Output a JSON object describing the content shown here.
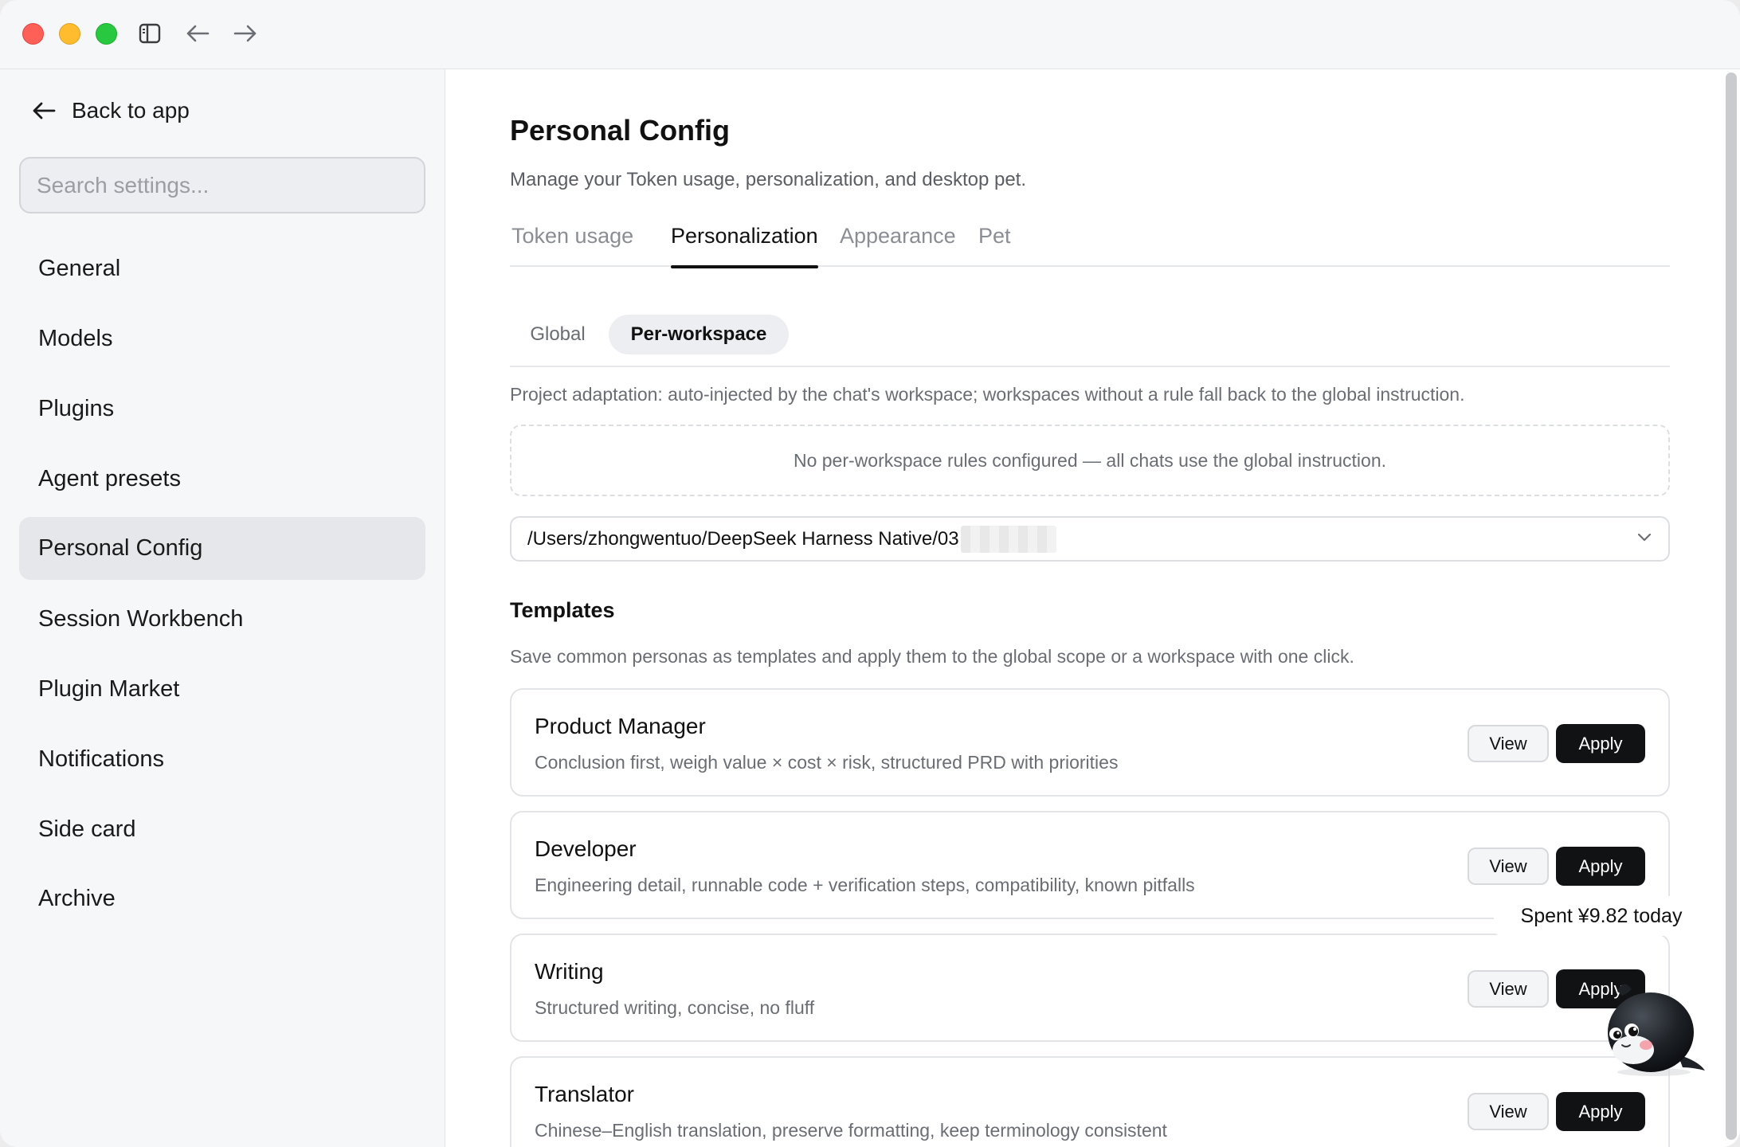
{
  "titlebar": {
    "sidebar_toggle_icon": "sidebar-toggle-icon",
    "back_icon": "arrow-left-icon",
    "forward_icon": "arrow-right-icon"
  },
  "sidebar": {
    "back_label": "Back to app",
    "search_placeholder": "Search settings...",
    "items": [
      {
        "label": "General",
        "active": false
      },
      {
        "label": "Models",
        "active": false
      },
      {
        "label": "Plugins",
        "active": false
      },
      {
        "label": "Agent presets",
        "active": false
      },
      {
        "label": "Personal Config",
        "active": true
      },
      {
        "label": "Session Workbench",
        "active": false
      },
      {
        "label": "Plugin Market",
        "active": false
      },
      {
        "label": "Notifications",
        "active": false
      },
      {
        "label": "Side card",
        "active": false
      },
      {
        "label": "Archive",
        "active": false
      }
    ]
  },
  "main": {
    "title": "Personal Config",
    "subtitle": "Manage your Token usage, personalization, and desktop pet.",
    "tabs": [
      {
        "label": "Token usage",
        "active": false
      },
      {
        "label": "Personalization",
        "active": true
      },
      {
        "label": "Appearance",
        "active": false
      },
      {
        "label": "Pet",
        "active": false
      }
    ],
    "subtabs": [
      {
        "label": "Global",
        "active": false
      },
      {
        "label": "Per-workspace",
        "active": true
      }
    ],
    "hint": "Project adaptation: auto-injected by the chat's workspace; workspaces without a rule fall back to the global instruction.",
    "empty_message": "No per-workspace rules configured — all chats use the global instruction.",
    "workspace_select_value": "/Users/zhongwentuo/DeepSeek Harness Native/03",
    "templates": {
      "title": "Templates",
      "description": "Save common personas as templates and apply them to the global scope or a workspace with one click.",
      "view_label": "View",
      "apply_label": "Apply",
      "items": [
        {
          "name": "Product Manager",
          "desc": "Conclusion first, weigh value × cost × risk, structured PRD with priorities"
        },
        {
          "name": "Developer",
          "desc": "Engineering detail, runnable code + verification steps, compatibility, known pitfalls"
        },
        {
          "name": "Writing",
          "desc": "Structured writing, concise, no fluff"
        },
        {
          "name": "Translator",
          "desc": "Chinese–English translation, preserve formatting, keep terminology consistent"
        }
      ]
    }
  },
  "pet": {
    "spent_text": "Spent ¥9.82 today"
  },
  "colors": {
    "accent": "#111214",
    "active_nav_bg": "#e5e7eb",
    "sidebar_bg": "#f6f7f9",
    "muted_text": "#6a6d73"
  }
}
